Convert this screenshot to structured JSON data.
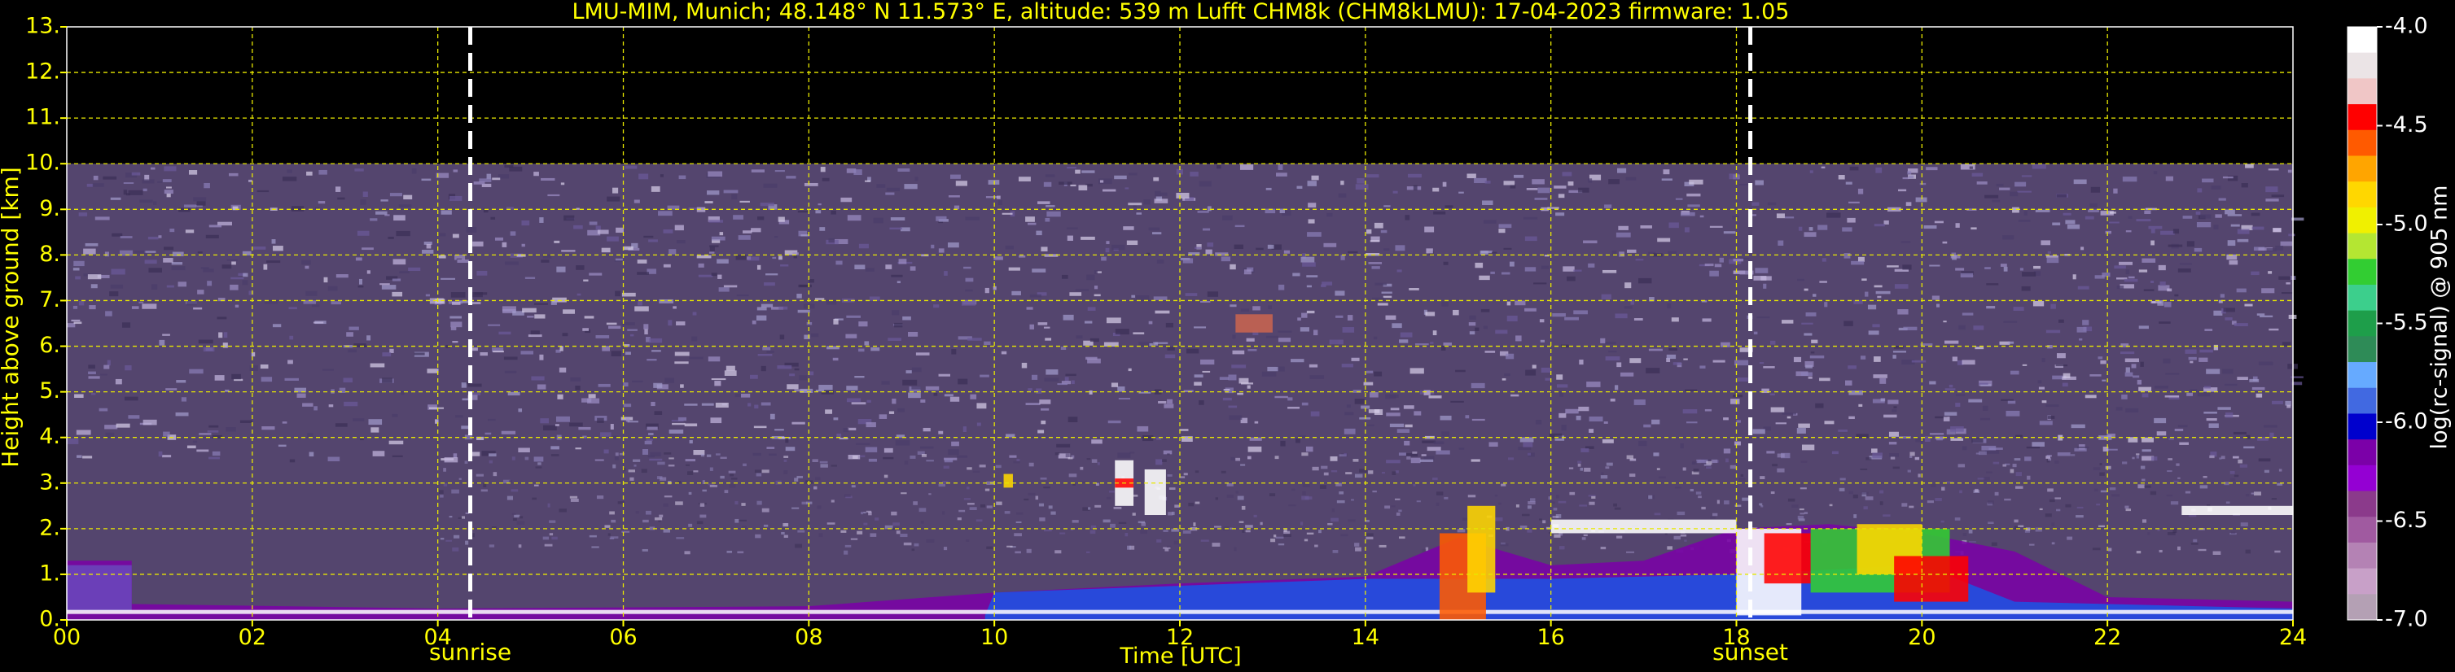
{
  "chart_data": {
    "type": "heatmap",
    "title": "LMU-MIM, Munich; 48.148° N 11.573° E, altitude: 539 m    Lufft CHM8k (CHM8kLMU): 17-04-2023    firmware: 1.05",
    "xlabel": "Time [UTC]",
    "ylabel": "Height above ground [km]",
    "xlim": [
      0,
      24
    ],
    "ylim": [
      0,
      13
    ],
    "x_ticks": [
      "00",
      "02",
      "04",
      "06",
      "08",
      "10",
      "12",
      "14",
      "16",
      "18",
      "20",
      "22",
      "24"
    ],
    "y_ticks": [
      "0.",
      "1.",
      "2.",
      "3.",
      "4.",
      "5.",
      "6.",
      "7.",
      "8.",
      "9.",
      "10.",
      "11.",
      "12.",
      "13."
    ],
    "grid": true,
    "signal_top_km": 10.0,
    "markers": [
      {
        "label": "sunrise",
        "time": 4.35
      },
      {
        "label": "sunset",
        "time": 18.15
      }
    ],
    "colorbar": {
      "label": "log(rc-signal) @ 905 nm",
      "range": [
        -7.0,
        -4.0
      ],
      "ticks": [
        "-4.0",
        "-4.5",
        "-5.0",
        "-5.5",
        "-6.0",
        "-6.5",
        "-7.0"
      ],
      "colors": [
        "#ffffff",
        "#ebe4e6",
        "#f0c6c6",
        "#ff0000",
        "#ff5a00",
        "#ffa500",
        "#ffd700",
        "#f0f000",
        "#b4e632",
        "#32cd32",
        "#3ccf8c",
        "#1e9e4a",
        "#2e8b57",
        "#66aaff",
        "#4169e1",
        "#0000cd",
        "#7b00a8",
        "#9400d3",
        "#8b3a8b",
        "#a05aa0",
        "#b482b4",
        "#c8a0c8",
        "#b4a0b4"
      ]
    },
    "features": [
      {
        "name": "boundary layer aerosol",
        "time": [
          0,
          24
        ],
        "height_km": [
          0.0,
          2.2
        ]
      },
      {
        "name": "cloud",
        "time": [
          11.3,
          11.8
        ],
        "height_km": [
          2.5,
          3.5
        ]
      },
      {
        "name": "cloud",
        "time": [
          16.0,
          18.0
        ],
        "height_km": [
          1.9,
          2.3
        ]
      },
      {
        "name": "cloud",
        "time": [
          18.0,
          20.5
        ],
        "height_km": [
          1.0,
          2.2
        ]
      },
      {
        "name": "cloud",
        "time": [
          22.8,
          24.0
        ],
        "height_km": [
          2.2,
          2.5
        ]
      }
    ]
  }
}
